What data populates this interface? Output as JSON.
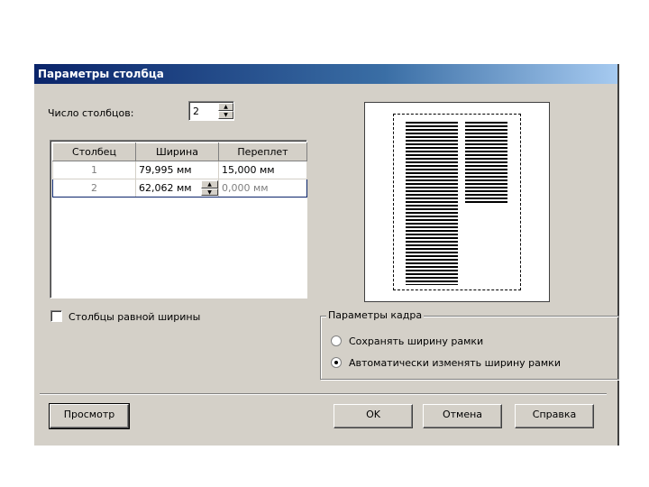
{
  "dialog": {
    "title": "Параметры столбца"
  },
  "columns_count": {
    "label": "Число столбцов:",
    "value": "2"
  },
  "table": {
    "headers": [
      "Столбец",
      "Ширина",
      "Переплет"
    ],
    "rows": [
      {
        "num": "1",
        "width": "79,995 мм",
        "gutter": "15,000 мм"
      },
      {
        "num": "2",
        "width": "62,062 мм",
        "gutter": "0,000 мм"
      }
    ]
  },
  "equal_width": {
    "label": "Столбцы равной ширины",
    "checked": false
  },
  "frame_settings": {
    "legend": "Параметры кадра",
    "options": [
      "Сохранять ширину рамки",
      "Автоматически изменять ширину рамки"
    ],
    "selected": "Автоматически изменять ширину рамки"
  },
  "buttons": {
    "preview": "Просмотр",
    "ok": "OK",
    "cancel": "Отмена",
    "help": "Справка"
  }
}
